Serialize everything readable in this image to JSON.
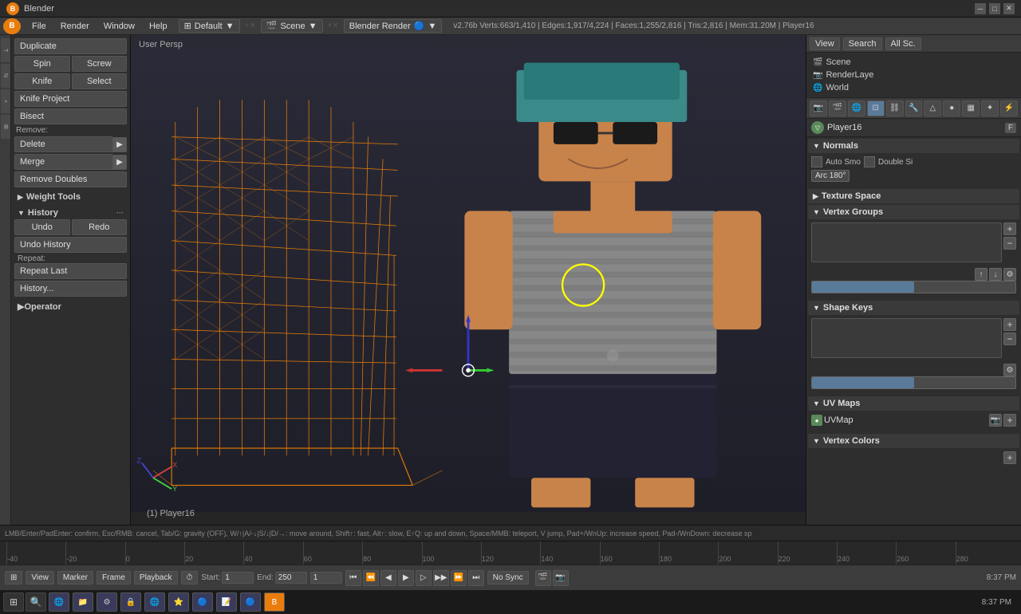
{
  "titlebar": {
    "title": "Blender",
    "logo": "B"
  },
  "menubar": {
    "items": [
      "File",
      "Render",
      "Window",
      "Help"
    ],
    "mode": "Default",
    "scene": "Scene",
    "render_engine": "Blender Render",
    "stats": "v2.76b Verts:663/1,410 | Edges:1,917/4,224 | Faces:1,255/2,816 | Tris:2,816 | Mem:31.20M | Player16"
  },
  "tools": {
    "duplicate_label": "Duplicate",
    "spin_label": "Spin",
    "screw_label": "Screw",
    "knife_label": "Knife",
    "select_label": "Select",
    "knife_project_label": "Knife Project",
    "bisect_label": "Bisect",
    "remove_label": "Remove:",
    "delete_label": "Delete",
    "merge_label": "Merge",
    "remove_doubles_label": "Remove Doubles",
    "weight_tools_label": "Weight Tools",
    "history_label": "History",
    "undo_label": "Undo",
    "redo_label": "Redo",
    "undo_history_label": "Undo History",
    "repeat_label": "Repeat:",
    "repeat_last_label": "Repeat Last",
    "history_dots_label": "History...",
    "operator_label": "Operator"
  },
  "viewport": {
    "label": "User Persp",
    "object_info": "(1) Player16"
  },
  "right_panel": {
    "view_label": "View",
    "search_label": "Search",
    "all_scenes_label": "All Sc.",
    "scene_label": "Scene",
    "render_layer_label": "RenderLaye",
    "world_label": "World",
    "player_label": "Player16",
    "f_badge": "F",
    "normals_label": "Normals",
    "auto_smooth_label": "Auto Smo",
    "double_sided_label": "Double Si",
    "arc_label": "Arc 180°",
    "texture_space_label": "Texture Space",
    "vertex_groups_label": "Vertex Groups",
    "shape_keys_label": "Shape Keys",
    "uv_maps_label": "UV Maps",
    "uvmap_label": "UVMap",
    "vertex_colors_label": "Vertex Colors"
  },
  "timeline": {
    "ticks": [
      "-40",
      "-20",
      "0",
      "20",
      "40",
      "60",
      "80",
      "100",
      "120",
      "140",
      "160",
      "180",
      "200",
      "220",
      "240",
      "260",
      "280"
    ]
  },
  "playbar": {
    "start_label": "Start:",
    "start_val": "1",
    "end_label": "End:",
    "end_val": "250",
    "current_val": "1",
    "sync_label": "No Sync"
  },
  "statusbar": {
    "text": "LMB/Enter/PadEnter: confirm, Esc/RMB: cancel, Tab/G: gravity (OFF), W/↑|A/-↓|S/↓|D/→: move around, Shift↑: fast, Alt↑: slow, E↑Q: up and down, Space/MMB: teleport, V jump, Pad+/WnUp: increase speed, Pad-/WnDown: decrease sp"
  },
  "clock": {
    "time": "8:37 PM"
  },
  "taskbar": {
    "apps": [
      "⊞",
      "🔍",
      "🌐",
      "📁",
      "⚙",
      "🔒",
      "🌐",
      "⭐",
      "🔵",
      "📝",
      "🔵",
      "🔷",
      "B"
    ]
  }
}
